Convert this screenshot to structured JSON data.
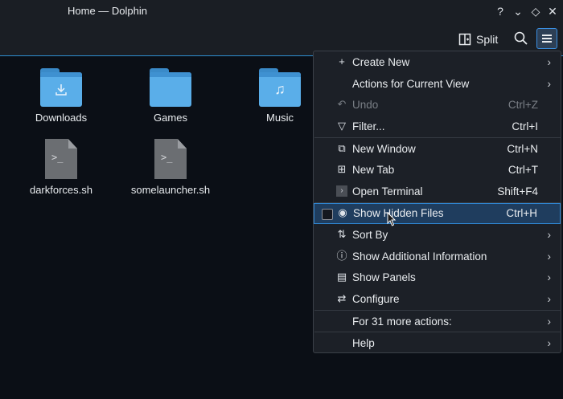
{
  "window": {
    "title": "Home — Dolphin"
  },
  "titlebar_buttons": [
    "?",
    "⌄",
    "◇",
    "✕"
  ],
  "toolbar": {
    "split_label": "Split"
  },
  "files": [
    {
      "name": "Downloads",
      "type": "folder",
      "glyph": "download-icon"
    },
    {
      "name": "Games",
      "type": "folder",
      "glyph": ""
    },
    {
      "name": "Music",
      "type": "folder",
      "glyph": "music-icon"
    },
    {
      "name": "darkforces.sh",
      "type": "script"
    },
    {
      "name": "somelauncher.sh",
      "type": "script"
    }
  ],
  "menu": {
    "items": [
      {
        "label": "Create New",
        "icon": "plus-icon",
        "shortcut": "",
        "submenu": true
      },
      {
        "label": "Actions for Current View",
        "icon": "",
        "shortcut": "",
        "submenu": true
      },
      {
        "label": "Undo",
        "icon": "undo-icon",
        "shortcut": "Ctrl+Z",
        "disabled": true
      },
      {
        "label": "Filter...",
        "icon": "filter-icon",
        "shortcut": "Ctrl+I"
      },
      {
        "label": "New Window",
        "icon": "new-window-icon",
        "shortcut": "Ctrl+N"
      },
      {
        "label": "New Tab",
        "icon": "new-tab-icon",
        "shortcut": "Ctrl+T"
      },
      {
        "label": "Open Terminal",
        "icon": "terminal-icon",
        "shortcut": "Shift+F4"
      },
      {
        "label": "Show Hidden Files",
        "icon": "eye-icon",
        "shortcut": "Ctrl+H",
        "checkbox": true,
        "checked": false,
        "highlighted": true
      },
      {
        "label": "Sort By",
        "icon": "sort-icon",
        "shortcut": "",
        "submenu": true
      },
      {
        "label": "Show Additional Information",
        "icon": "info-icon",
        "shortcut": "",
        "submenu": true
      },
      {
        "label": "Show Panels",
        "icon": "panels-icon",
        "shortcut": "",
        "submenu": true
      },
      {
        "label": "Configure",
        "icon": "configure-icon",
        "shortcut": "",
        "submenu": true
      },
      {
        "label": "For 31 more actions:",
        "icon": "",
        "shortcut": "",
        "submenu": true
      },
      {
        "label": "Help",
        "icon": "",
        "shortcut": "",
        "submenu": true
      }
    ]
  }
}
